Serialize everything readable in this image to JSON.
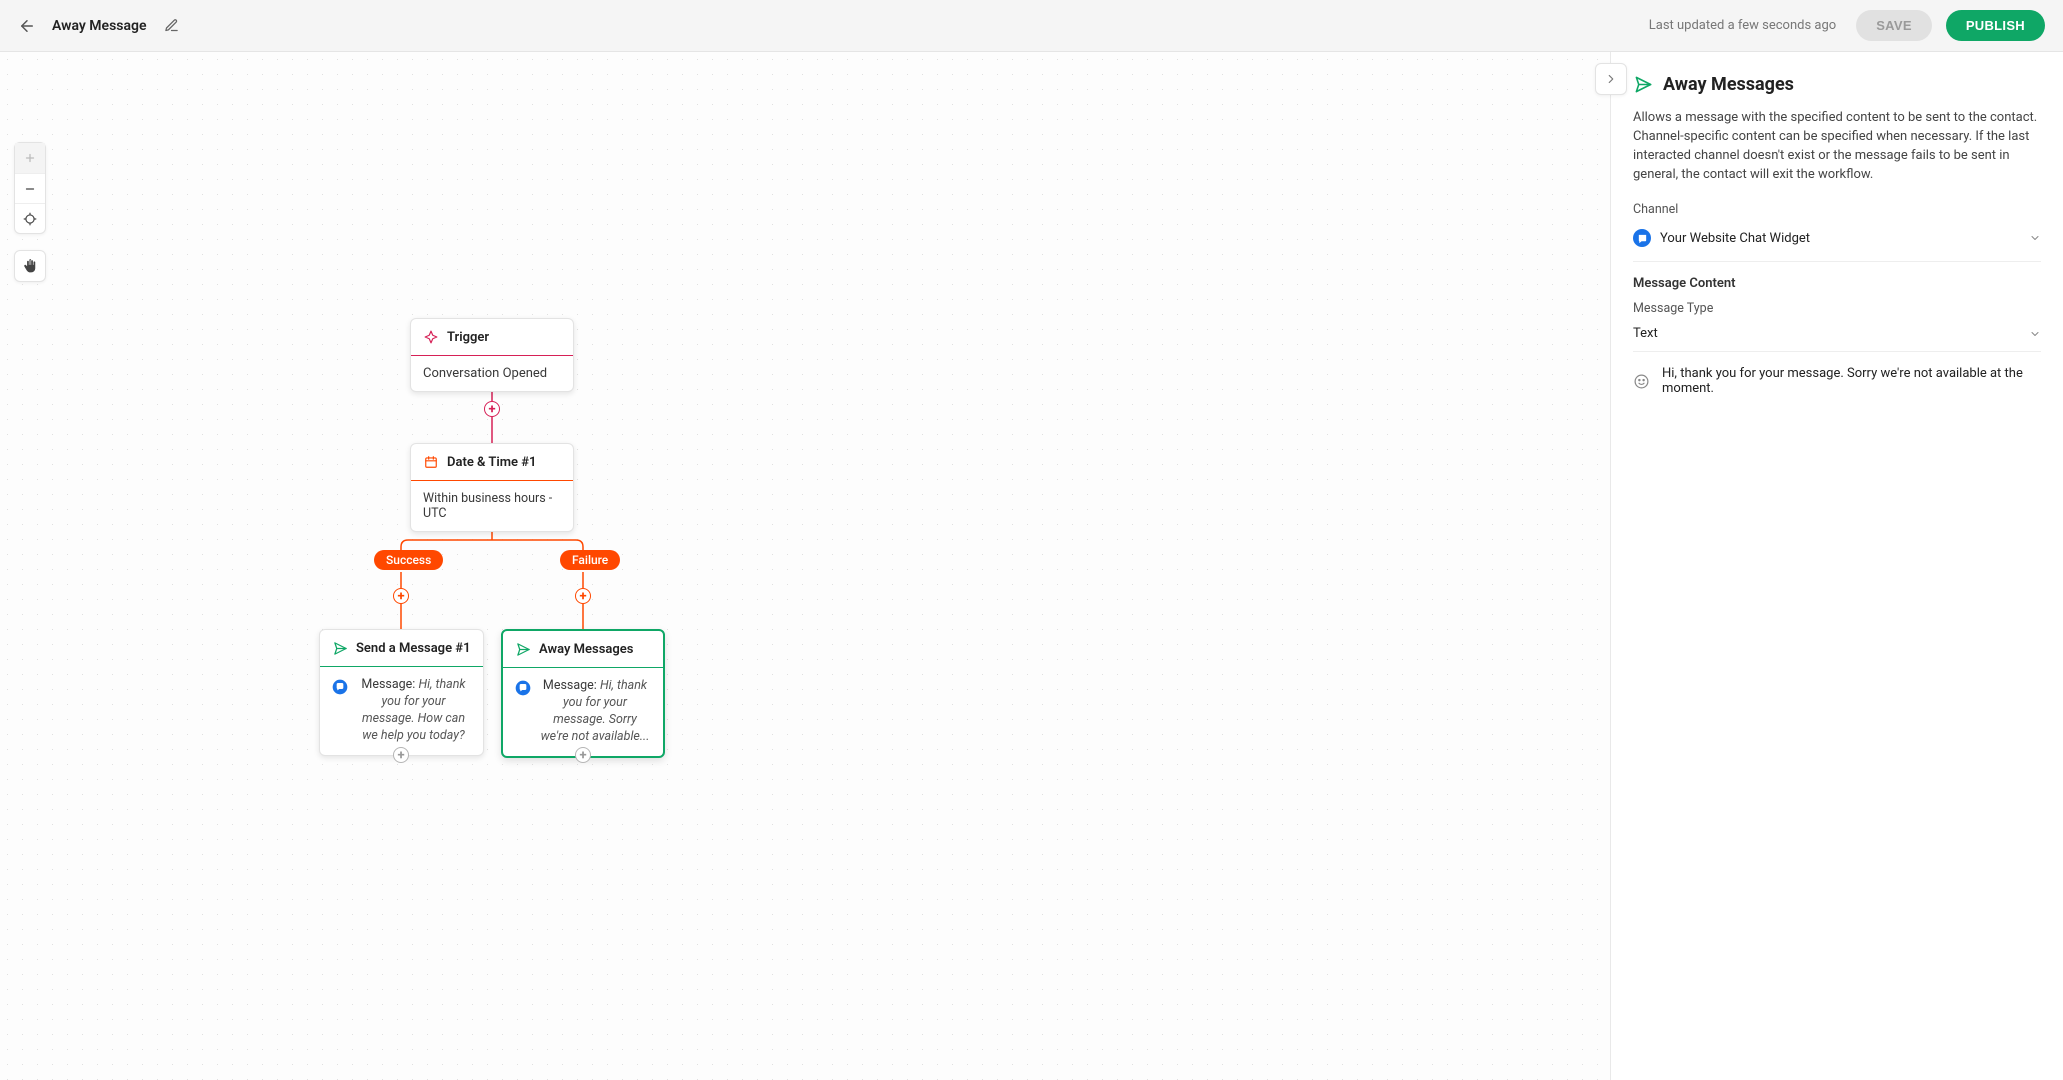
{
  "header": {
    "title": "Away Message",
    "last_updated": "Last updated a few seconds ago",
    "save_label": "SAVE",
    "publish_label": "PUBLISH"
  },
  "nodes": {
    "trigger": {
      "title": "Trigger",
      "body": "Conversation Opened"
    },
    "datetime": {
      "title": "Date & Time #1",
      "body": "Within business hours - UTC"
    },
    "branches": {
      "success": "Success",
      "failure": "Failure"
    },
    "send_msg": {
      "title": "Send a Message #1",
      "prefix": "Message: ",
      "text": "Hi, thank you for your message. How can we help you today?"
    },
    "away_msg": {
      "title": "Away Messages",
      "prefix": "Message: ",
      "text": "Hi, thank you for your message. Sorry we're not available..."
    }
  },
  "panel": {
    "title": "Away Messages",
    "description": "Allows a message with the specified content to be sent to the contact. Channel-specific content can be specified when necessary. If the last interacted channel doesn't exist or the message fails to be sent in general, the contact will exit the workflow.",
    "channel_label": "Channel",
    "channel_value": "Your Website Chat Widget",
    "mc_label": "Message Content",
    "type_label": "Message Type",
    "type_value": "Text",
    "message_preview": "Hi, thank you for your message. Sorry we're not available at the moment."
  }
}
